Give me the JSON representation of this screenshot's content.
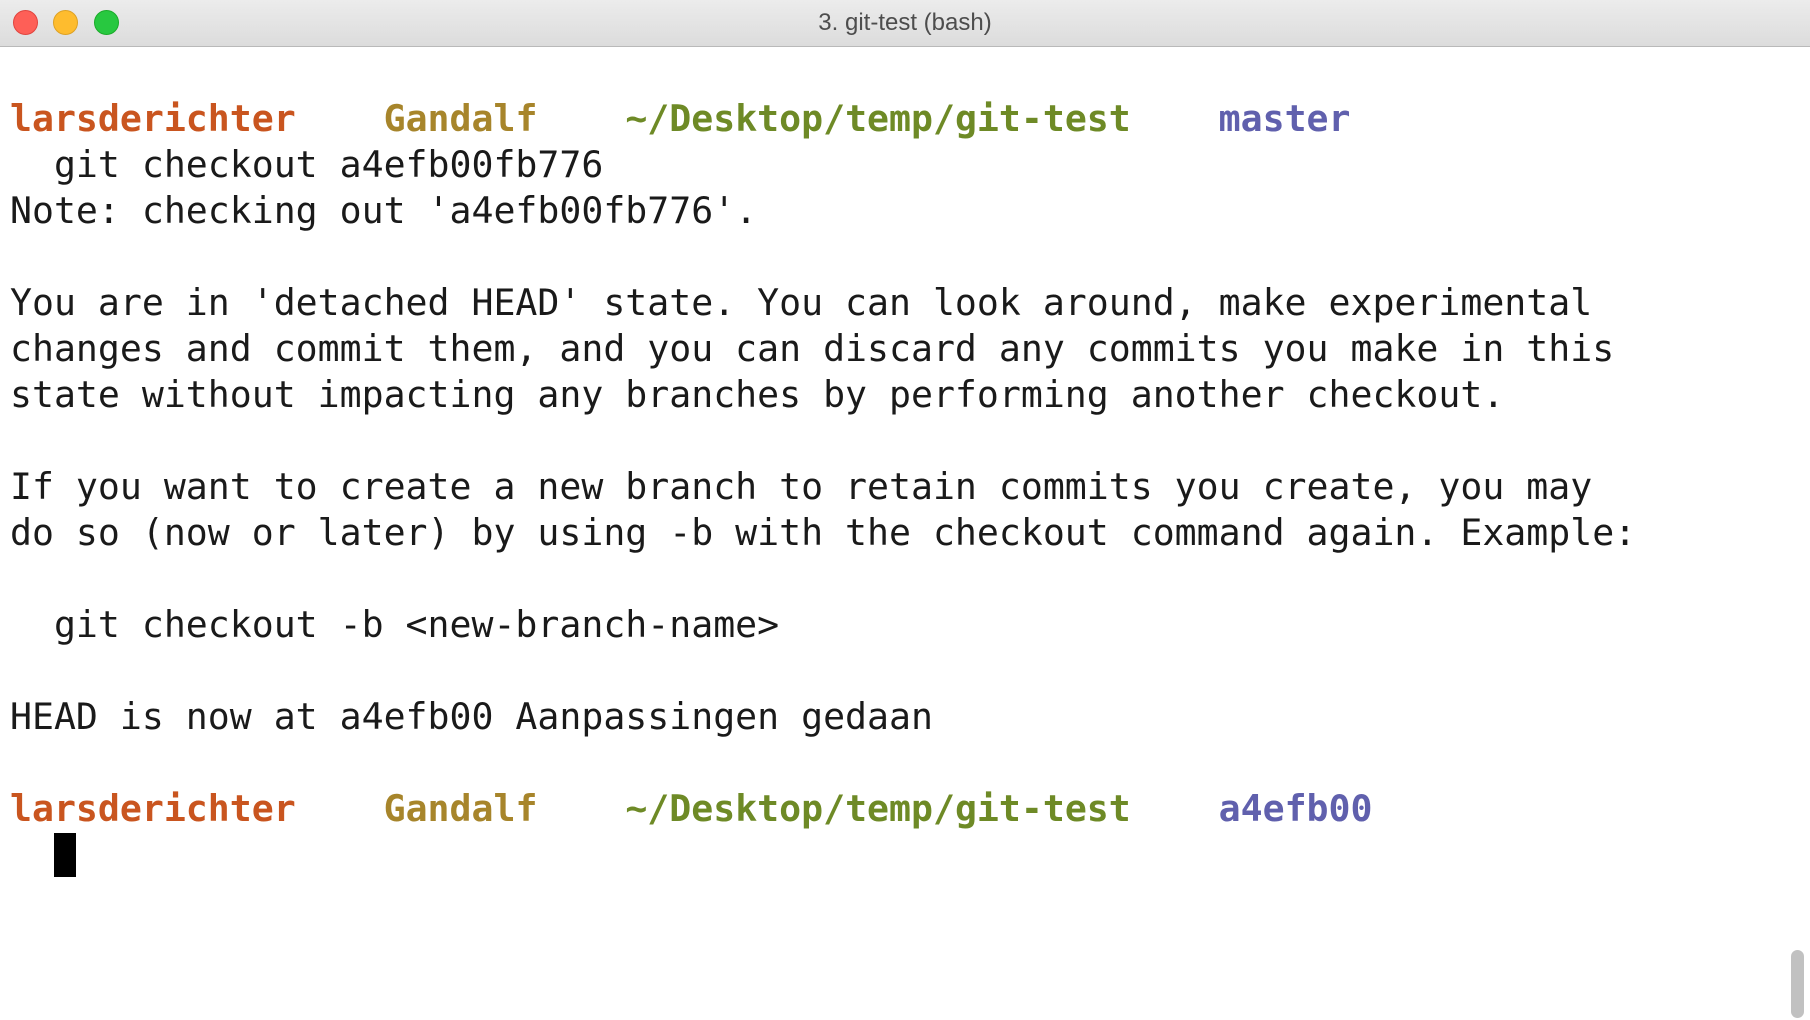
{
  "window": {
    "title": "3. git-test (bash)"
  },
  "prompt1": {
    "user": "larsderichter",
    "host": "Gandalf",
    "path": "~/Desktop/temp/git-test",
    "branch": "master"
  },
  "command1": "  git checkout a4efb00fb776",
  "output": {
    "note": "Note: checking out 'a4efb00fb776'.",
    "detached_1": "You are in 'detached HEAD' state. You can look around, make experimental",
    "detached_2": "changes and commit them, and you can discard any commits you make in this",
    "detached_3": "state without impacting any branches by performing another checkout.",
    "branch_1": "If you want to create a new branch to retain commits you create, you may",
    "branch_2": "do so (now or later) by using -b with the checkout command again. Example:",
    "example": "  git checkout -b <new-branch-name>",
    "head": "HEAD is now at a4efb00 Aanpassingen gedaan"
  },
  "prompt2": {
    "user": "larsderichter",
    "host": "Gandalf",
    "path": "~/Desktop/temp/git-test",
    "branch": "a4efb00"
  },
  "colors": {
    "user": "#c9551f",
    "host": "#a7852b",
    "path": "#6e8a26",
    "branch": "#6060ad"
  }
}
